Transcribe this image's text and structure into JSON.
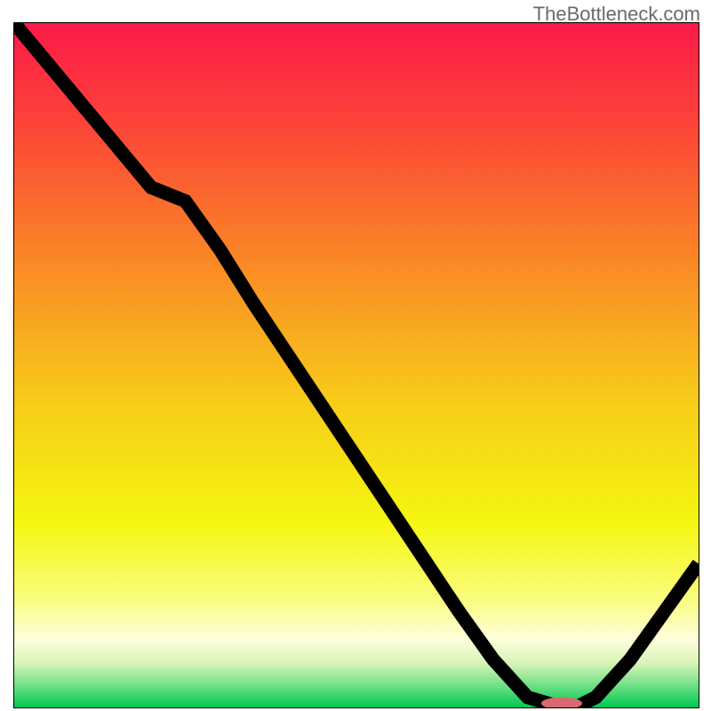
{
  "attribution": "TheBottleneck.com",
  "chart_data": {
    "type": "line",
    "title": "",
    "xlabel": "",
    "ylabel": "",
    "xlim": [
      0,
      100
    ],
    "ylim": [
      0,
      100
    ],
    "grid": false,
    "legend": false,
    "series": [
      {
        "name": "bottleneck-curve",
        "x": [
          0,
          5,
          10,
          15,
          20,
          25,
          30,
          35,
          40,
          45,
          50,
          55,
          60,
          65,
          70,
          75,
          80,
          82,
          85,
          90,
          95,
          100
        ],
        "y": [
          100,
          94,
          88,
          82,
          76,
          74,
          67,
          59,
          51.5,
          44,
          36.5,
          29,
          21.5,
          14,
          7,
          1.5,
          0,
          0,
          1.5,
          7,
          14,
          21
        ]
      }
    ],
    "marker": {
      "name": "optimal-range",
      "x_start": 77,
      "x_end": 83,
      "y": 0.6,
      "color": "#d86a6f"
    },
    "background_stops": [
      {
        "offset": 0.0,
        "color": "#fb1a48"
      },
      {
        "offset": 0.15,
        "color": "#fc4438"
      },
      {
        "offset": 0.33,
        "color": "#fa8227"
      },
      {
        "offset": 0.55,
        "color": "#f7cb19"
      },
      {
        "offset": 0.73,
        "color": "#f5f610"
      },
      {
        "offset": 0.84,
        "color": "#fafd7c"
      },
      {
        "offset": 0.9,
        "color": "#fefedb"
      },
      {
        "offset": 0.935,
        "color": "#d9f4b8"
      },
      {
        "offset": 0.965,
        "color": "#7ae28a"
      },
      {
        "offset": 1.0,
        "color": "#00c853"
      }
    ]
  }
}
